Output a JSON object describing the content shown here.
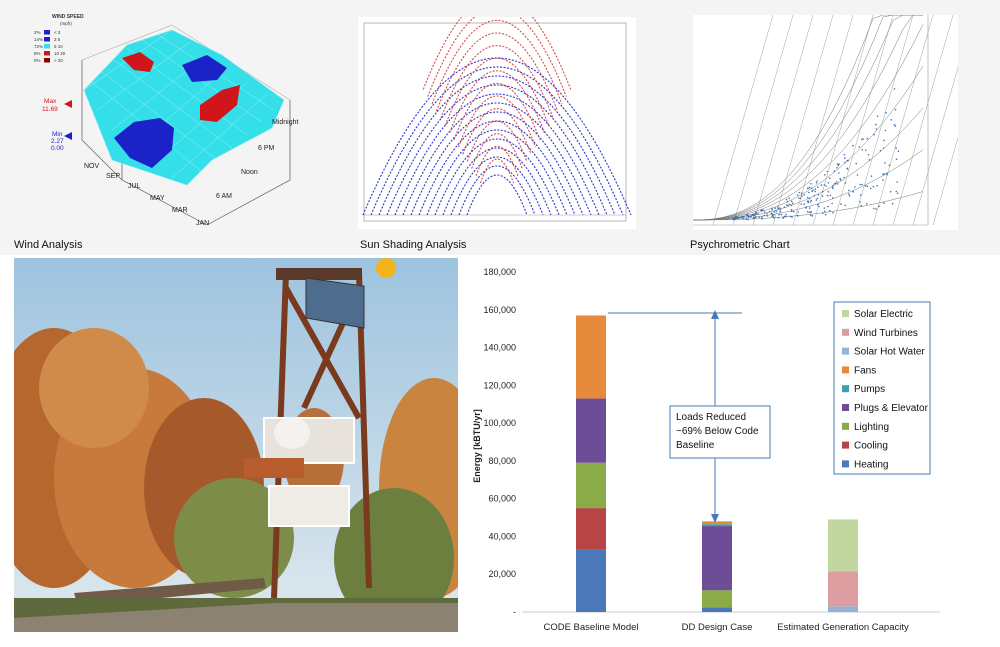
{
  "wind": {
    "caption": "Wind Analysis",
    "legend_title": "WIND SPEED",
    "legend_unit": "(mph)",
    "legend_rows": [
      {
        "pct": "2%",
        "label": "< 3",
        "color": "#1a22c8"
      },
      {
        "pct": "14%",
        "label": "3   5",
        "color": "#1a22c8"
      },
      {
        "pct": "72%",
        "label": "5   10",
        "color": "#33e0e8"
      },
      {
        "pct": "8%",
        "label": "10  20",
        "color": "#d01818"
      },
      {
        "pct": "0%",
        "label": "> 20",
        "color": "#8a0000"
      }
    ],
    "max_label": "Max",
    "max_value": "11.69",
    "min_label": "Min",
    "min_value_1": "2.27",
    "min_value_2": "0.00",
    "month_labels": [
      "NOV",
      "SEP",
      "JUL",
      "MAY",
      "MAR",
      "JAN"
    ],
    "time_labels": [
      "Midnight",
      "6 PM",
      "Noon",
      "6 AM"
    ]
  },
  "sun": {
    "caption": "Sun Shading Analysis"
  },
  "psychro": {
    "caption": "Psychrometric Chart"
  },
  "chart_data": {
    "type": "bar",
    "stacked": true,
    "categories": [
      "CODE Baseline Model",
      "DD Design Case",
      "Estimated Generation Capacity"
    ],
    "ylabel": "Energy [kBTU/yr]",
    "ylim": [
      0,
      180000
    ],
    "yticks": [
      "-",
      "20,000",
      "40,000",
      "60,000",
      "80,000",
      "100,000",
      "120,000",
      "140,000",
      "160,000",
      "180,000"
    ],
    "series": [
      {
        "name": "Heating",
        "color": "#4a78b8",
        "values": [
          33000,
          2500,
          0
        ]
      },
      {
        "name": "Cooling",
        "color": "#b84545",
        "values": [
          22000,
          0,
          0
        ]
      },
      {
        "name": "Lighting",
        "color": "#8aab47",
        "values": [
          24000,
          9000,
          0
        ]
      },
      {
        "name": "Plugs & Elevator",
        "color": "#6c4d96",
        "values": [
          34000,
          34000,
          0
        ]
      },
      {
        "name": "Pumps",
        "color": "#3ca0b4",
        "values": [
          0,
          1000,
          0
        ]
      },
      {
        "name": "Fans",
        "color": "#e68a3c",
        "values": [
          44000,
          1500,
          0
        ]
      },
      {
        "name": "Solar Hot Water",
        "color": "#98b1d6",
        "values": [
          0,
          0,
          3000
        ]
      },
      {
        "name": "Wind Turbines",
        "color": "#dc9ea0",
        "values": [
          0,
          0,
          18500
        ]
      },
      {
        "name": "Solar Electric",
        "color": "#c2d6a0",
        "values": [
          0,
          0,
          27500
        ]
      }
    ],
    "legend_order": [
      "Solar Electric",
      "Wind Turbines",
      "Solar Hot Water",
      "Fans",
      "Pumps",
      "Plugs & Elevator",
      "Lighting",
      "Cooling",
      "Heating"
    ],
    "legend_position": "right",
    "annotation": [
      "Loads Reduced",
      "~69% Below Code",
      "Baseline"
    ]
  }
}
